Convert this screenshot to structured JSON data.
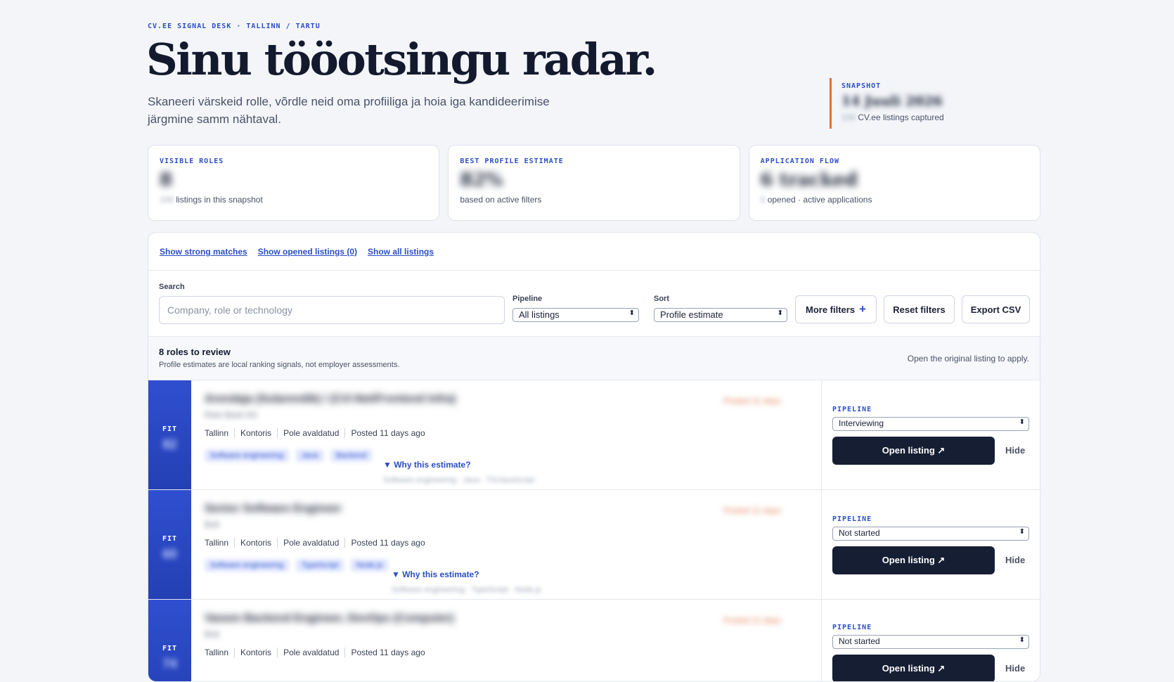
{
  "header": {
    "eyebrow": "CV.EE SIGNAL DESK · TALLINN / TARTU",
    "title": "Sinu tööotsingu radar.",
    "subtitle": "Skaneeri värskeid rolle, võrdle neid oma profiiliga ja hoia iga kandideerimise järgmine samm nähtaval."
  },
  "snapshot": {
    "label": "SNAPSHOT",
    "date": "14 Juuli 2026",
    "count": "100",
    "caption": "CV.ee listings captured"
  },
  "stats": [
    {
      "label": "VISIBLE ROLES",
      "value": "8",
      "prefix": "100",
      "caption": "listings in this snapshot"
    },
    {
      "label": "BEST PROFILE ESTIMATE",
      "value": "82%",
      "prefix": "",
      "caption": "based on active filters"
    },
    {
      "label": "APPLICATION FLOW",
      "value": "6 tracked",
      "prefix": "0",
      "caption": "opened · active applications"
    }
  ],
  "quicklinks": [
    "Show strong matches",
    "Show opened listings (0)",
    "Show all listings"
  ],
  "filters": {
    "search_label": "Search",
    "search_placeholder": "Company, role or technology",
    "pipeline_label": "Pipeline",
    "pipeline_value": "All listings",
    "sort_label": "Sort",
    "sort_value": "Profile estimate",
    "more_filters": "More filters",
    "reset_filters": "Reset filters",
    "export_csv": "Export CSV"
  },
  "review": {
    "title": "8 roles to review",
    "subtitle": "Profile estimates are local ranking signals, not employer assessments.",
    "right_note": "Open the original listing to apply."
  },
  "listings": [
    {
      "fit_label": "FIT",
      "fit_value": "82",
      "title": "Arendaja (Sularendik) / (C#/.Net/Frontend Infra)",
      "company": "Rete Bank AS",
      "salary": "Posted 11 days",
      "location": "Tallinn",
      "workplace": "Kontoris",
      "salary_note": "Pole avaldatud",
      "posted": "Posted 11 days ago",
      "tags": [
        "Software engineering",
        "Java",
        "Backend"
      ],
      "why": "▼ Why this estimate?",
      "why_sub": "Software engineering · Java · TS/JavaScript",
      "pipeline_label": "PIPELINE",
      "pipeline_value": "Interviewing",
      "open_label": "Open listing ↗",
      "hide_label": "Hide"
    },
    {
      "fit_label": "FIT",
      "fit_value": "60",
      "title": "Senior Software Engineer",
      "company": "Bolt",
      "salary": "Posted 11 days",
      "location": "Tallinn",
      "workplace": "Kontoris",
      "salary_note": "Pole avaldatud",
      "posted": "Posted 11 days ago",
      "tags": [
        "Software engineering",
        "TypeScript",
        "Node.js"
      ],
      "why": "▼ Why this estimate?",
      "why_sub": "Software engineering · TypeScript · Node.js",
      "pipeline_label": "PIPELINE",
      "pipeline_value": "Not started",
      "open_label": "Open listing ↗",
      "hide_label": "Hide"
    },
    {
      "fit_label": "FIT",
      "fit_value": "74",
      "title": "Vanem Backend Engineer, DevOps (Computer)",
      "company": "Bolt",
      "salary": "Posted 11 days",
      "location": "Tallinn",
      "workplace": "Kontoris",
      "salary_note": "Pole avaldatud",
      "posted": "Posted 11 days ago",
      "tags": [],
      "why": "",
      "why_sub": "",
      "pipeline_label": "PIPELINE",
      "pipeline_value": "Not started",
      "open_label": "Open listing ↗",
      "hide_label": "Hide"
    }
  ]
}
